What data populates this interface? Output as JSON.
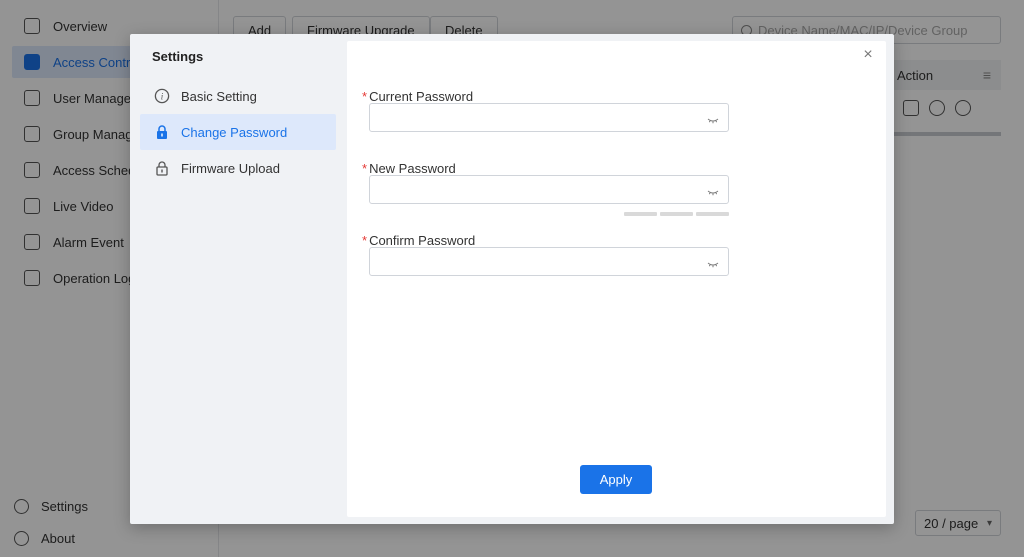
{
  "sidebar": {
    "items": [
      {
        "label": "Overview",
        "icon": "grid-icon"
      },
      {
        "label": "Access Contro",
        "icon": "access-control-icon"
      },
      {
        "label": "User Manager",
        "icon": "user-icon"
      },
      {
        "label": "Group Manage",
        "icon": "group-icon"
      },
      {
        "label": "Access Schedu",
        "icon": "calendar-icon"
      },
      {
        "label": "Live Video",
        "icon": "video-icon"
      },
      {
        "label": "Alarm Event",
        "icon": "alarm-icon"
      },
      {
        "label": "Operation Log",
        "icon": "log-icon"
      }
    ],
    "settings_label": "Settings",
    "about_label": "About"
  },
  "toolbar": {
    "add_label": "Add",
    "firmware_upgrade_label": "Firmware Upgrade",
    "delete_label": "Delete",
    "search_placeholder": "Device Name/MAC/IP/Device Group"
  },
  "table": {
    "action_header": "Action"
  },
  "pagination": {
    "page_size": "20 / page"
  },
  "modal": {
    "title": "Settings",
    "menu": [
      {
        "label": "Basic Setting",
        "icon": "info-icon"
      },
      {
        "label": "Change Password",
        "icon": "lock-icon"
      },
      {
        "label": "Firmware Upload",
        "icon": "lock-open-icon"
      }
    ],
    "fields": {
      "current_password": {
        "label": "Current Password",
        "value": ""
      },
      "new_password": {
        "label": "New Password",
        "value": ""
      },
      "confirm_password": {
        "label": "Confirm Password",
        "value": ""
      }
    },
    "required_mark": "*",
    "apply_label": "Apply",
    "close_glyph": "×"
  },
  "colors": {
    "accent": "#1a73e8",
    "required": "#e53935"
  }
}
